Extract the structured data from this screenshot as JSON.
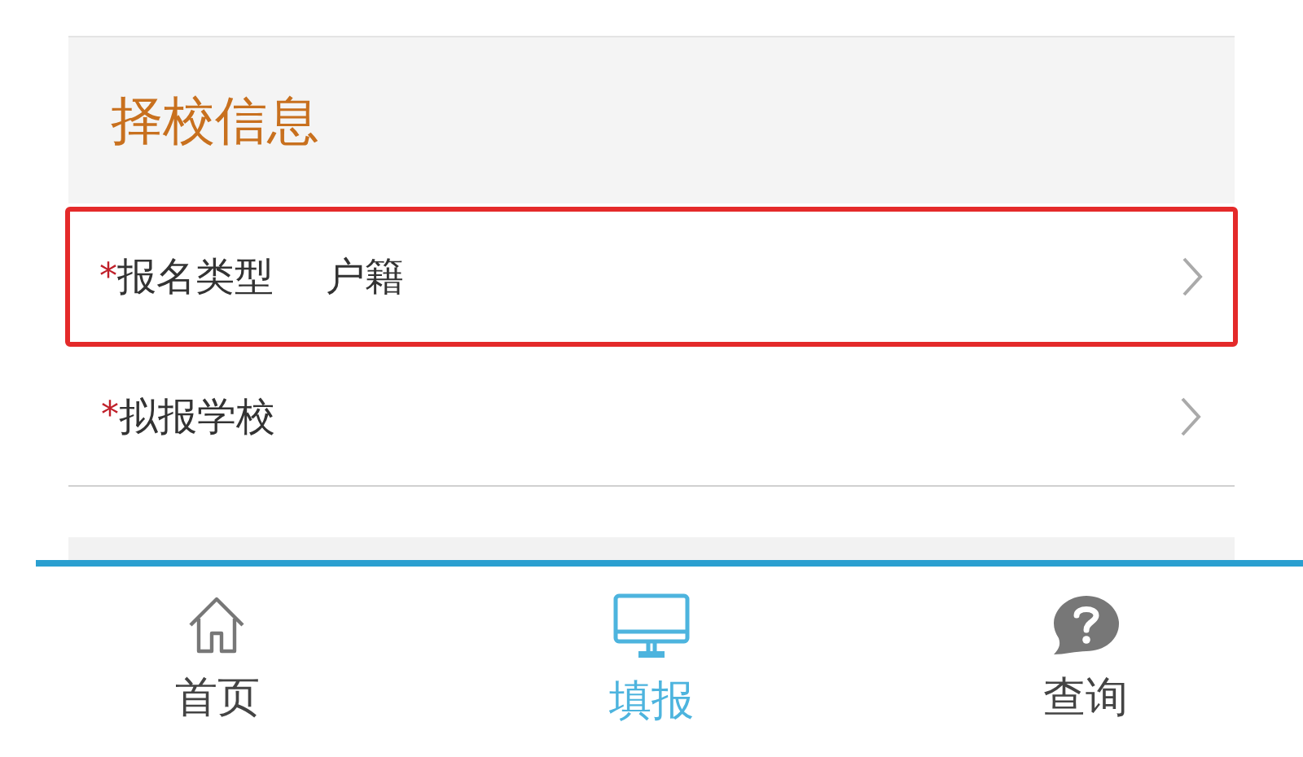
{
  "section": {
    "title": "择校信息"
  },
  "rows": [
    {
      "required_mark": "*",
      "label": "报名类型",
      "value": "户籍",
      "highlighted": true
    },
    {
      "required_mark": "*",
      "label": "拟报学校",
      "highlighted": false
    }
  ],
  "tabs": [
    {
      "label": "首页",
      "kind": "home",
      "selected": false
    },
    {
      "label": "填报",
      "kind": "monitor",
      "selected": true
    },
    {
      "label": "查询",
      "kind": "question",
      "selected": false
    }
  ]
}
